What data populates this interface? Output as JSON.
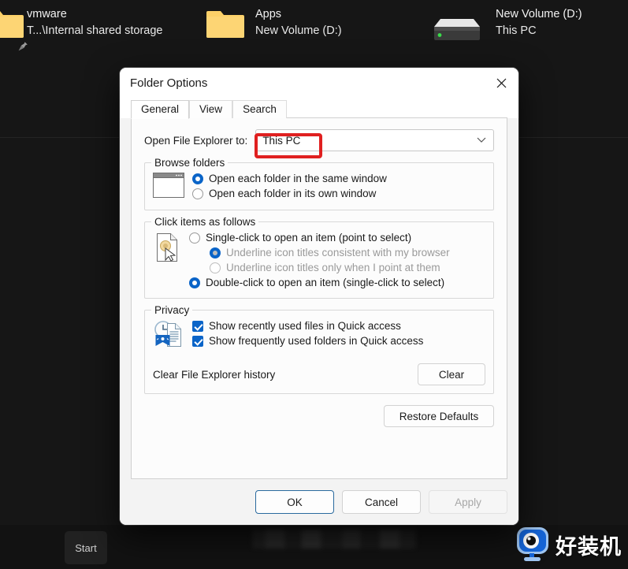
{
  "desktop": {
    "icons": [
      {
        "name": "vmware-shared-storage",
        "icon": "folder-icon",
        "line1": "vmware",
        "line2": "T...\\Internal shared storage",
        "pinned": true
      },
      {
        "name": "apps-folder",
        "icon": "folder-icon",
        "line1": "Apps",
        "line2": "New Volume (D:)",
        "pinned": false
      },
      {
        "name": "new-volume-drive",
        "icon": "drive-icon",
        "line1": "New Volume (D:)",
        "line2": "This PC",
        "pinned": false
      }
    ]
  },
  "taskbar": {
    "start_label": "Start"
  },
  "watermark": {
    "text": "好装机",
    "logo_icon": "eye-monitor-logo-icon"
  },
  "dialog": {
    "title": "Folder Options",
    "close_icon": "close-icon",
    "tabs": [
      {
        "label": "General",
        "active": true
      },
      {
        "label": "View",
        "active": false
      },
      {
        "label": "Search",
        "active": false
      }
    ],
    "open_file_explorer": {
      "label": "Open File Explorer to:",
      "value": "This PC",
      "chevron_icon": "chevron-down-icon",
      "highlight_color": "#e02020"
    },
    "browse_folders": {
      "legend": "Browse folders",
      "icon": "window-icon",
      "options": [
        {
          "label": "Open each folder in the same window",
          "checked": true
        },
        {
          "label": "Open each folder in its own window",
          "checked": false
        }
      ]
    },
    "click_items": {
      "legend": "Click items as follows",
      "icon": "click-document-icon",
      "options": [
        {
          "label": "Single-click to open an item (point to select)",
          "checked": false,
          "sub": false,
          "disabled": false
        },
        {
          "label": "Underline icon titles consistent with my browser",
          "checked": true,
          "sub": true,
          "disabled": true
        },
        {
          "label": "Underline icon titles only when I point at them",
          "checked": false,
          "sub": true,
          "disabled": true
        },
        {
          "label": "Double-click to open an item (single-click to select)",
          "checked": true,
          "sub": false,
          "disabled": false
        }
      ]
    },
    "privacy": {
      "legend": "Privacy",
      "icon": "quick-access-icon",
      "checkboxes": [
        {
          "label": "Show recently used files in Quick access",
          "checked": true
        },
        {
          "label": "Show frequently used folders in Quick access",
          "checked": true
        }
      ],
      "history_label": "Clear File Explorer history",
      "clear_button": "Clear"
    },
    "restore_defaults_button": "Restore Defaults",
    "footer": {
      "ok": "OK",
      "cancel": "Cancel",
      "apply": "Apply",
      "apply_disabled": true
    }
  },
  "colors": {
    "accent": "#0a64c8",
    "highlight": "#e02020",
    "desktop_bg": "#161616"
  }
}
